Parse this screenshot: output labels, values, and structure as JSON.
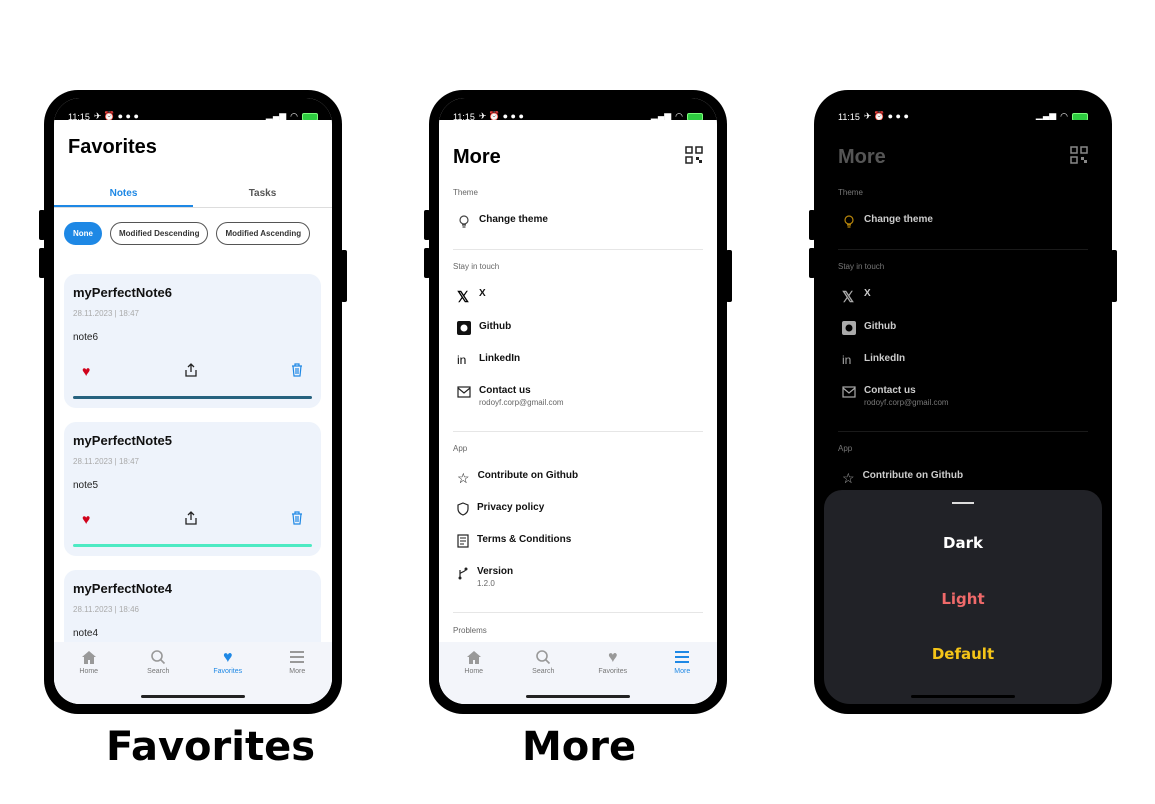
{
  "status": {
    "time": "11:15"
  },
  "favorites": {
    "title": "Favorites",
    "tabs": [
      "Notes",
      "Tasks"
    ],
    "chips": [
      "None",
      "Modified Descending",
      "Modified Ascending"
    ],
    "notes": [
      {
        "title": "myPerfectNote6",
        "date": "28.11.2023 | 18:47",
        "body": "note6",
        "bar_color": "#26627f"
      },
      {
        "title": "myPerfectNote5",
        "date": "28.11.2023 | 18:47",
        "body": "note5",
        "bar_color": "#4deac3"
      },
      {
        "title": "myPerfectNote4",
        "date": "28.11.2023 | 18:46",
        "body": "note4"
      }
    ],
    "caption": "Favorites"
  },
  "nav": {
    "home": "Home",
    "search": "Search",
    "favorites": "Favorites",
    "more": "More"
  },
  "more": {
    "title": "More",
    "section_theme": "Theme",
    "change_theme": "Change theme",
    "section_touch": "Stay in touch",
    "x": "X",
    "github": "Github",
    "linkedin": "LinkedIn",
    "contact": "Contact us",
    "email": "rodoyf.corp@gmail.com",
    "section_app": "App",
    "contribute": "Contribute on Github",
    "privacy": "Privacy policy",
    "terms": "Terms & Conditions",
    "version_label": "Version",
    "version_value": "1.2.0",
    "section_problems": "Problems",
    "caption": "More"
  },
  "theme_sheet": {
    "dark": "Dark",
    "light": "Light",
    "default": "Default",
    "colors": {
      "dark": "#ffffff",
      "light": "#f06a6a",
      "default": "#f5c518"
    }
  }
}
